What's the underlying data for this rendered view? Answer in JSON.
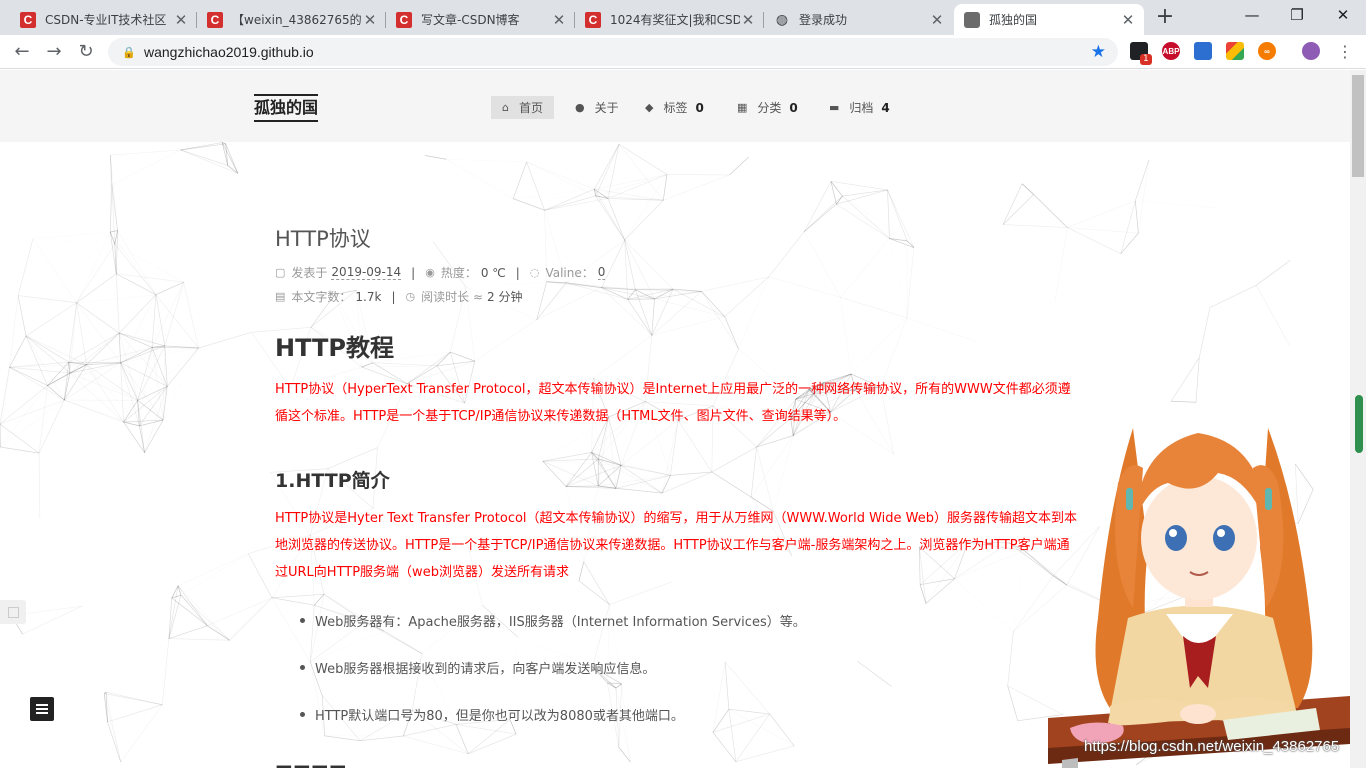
{
  "browser": {
    "tabs": [
      {
        "title": "CSDN-专业IT技术社区",
        "icon": "csdn-icon"
      },
      {
        "title": "【weixin_43862765的",
        "icon": "csdn-icon"
      },
      {
        "title": "写文章-CSDN博客",
        "icon": "csdn-icon"
      },
      {
        "title": "1024有奖征文|我和CSD",
        "icon": "csdn-icon"
      },
      {
        "title": "登录成功",
        "icon": "globe-icon"
      },
      {
        "title": "孤独的国",
        "icon": "site-avatar-icon",
        "active": true
      }
    ],
    "url": "wangzhichao2019.github.io",
    "extension_badge": "1",
    "extensions": [
      {
        "name": "notification-extension-icon",
        "label": "",
        "color": "#202124"
      },
      {
        "name": "adblock-plus-icon",
        "label": "ABP",
        "color": "#c70d2c"
      },
      {
        "name": "screenshot-extension-icon",
        "label": "",
        "color": "#2c6fd1"
      },
      {
        "name": "colorful-extension-icon",
        "label": "",
        "color": "#34a853"
      },
      {
        "name": "infinity-extension-icon",
        "label": "∞",
        "color": "#f57c00"
      },
      {
        "name": "profile-avatar-icon",
        "label": "",
        "color": "#8e5bb5"
      }
    ]
  },
  "site": {
    "brand": "孤独的国",
    "menu": [
      {
        "label": "首页",
        "icon": "home-icon",
        "active": true
      },
      {
        "label": "关于",
        "icon": "user-icon"
      },
      {
        "label": "标签",
        "icon": "tags-icon",
        "count": "0"
      },
      {
        "label": "分类",
        "icon": "th-icon",
        "count": "0"
      },
      {
        "label": "归档",
        "icon": "archive-icon",
        "count": "4"
      }
    ]
  },
  "post": {
    "title": "HTTP协议",
    "meta": {
      "posted_label": "发表于",
      "posted_date": "2019-09-14",
      "heat_label": "热度：",
      "heat_value": "0 ℃",
      "valine_label": "Valine：",
      "valine_value": "0",
      "wordcount_label": "本文字数：",
      "wordcount_value": "1.7k",
      "readtime_label": "阅读时长 ≈",
      "readtime_value": "2 分钟"
    },
    "h1": "HTTP教程",
    "intro": "HTTP协议（HyperText Transfer Protocol，超文本传输协议）是Internet上应用最广泛的一种网络传输协议，所有的WWW文件都必须遵循这个标准。HTTP是一个基于TCP/IP通信协议来传递数据（HTML文件、图片文件、查询结果等）。",
    "h2": "1.HTTP简介",
    "para2": "HTTP协议是Hyter Text Transfer Protocol（超文本传输协议）的缩写，用于从万维网（WWW.World Wide Web）服务器传输超文本到本地浏览器的传送协议。HTTP是一个基于TCP/IP通信协议来传递数据。HTTP协议工作与客户端-服务端架构之上。浏览器作为HTTP客户端通过URL向HTTP服务端（web浏览器）发送所有请求",
    "bullets": [
      "Web服务器有：Apache服务器，IIS服务器（Internet Information Services）等。",
      "Web服务器根据接收到的请求后，向客户端发送响应信息。",
      "HTTP默认端口号为80，但是你也可以改为8080或者其他端口。"
    ]
  },
  "watermark": "https://blog.csdn.net/weixin_43862765"
}
